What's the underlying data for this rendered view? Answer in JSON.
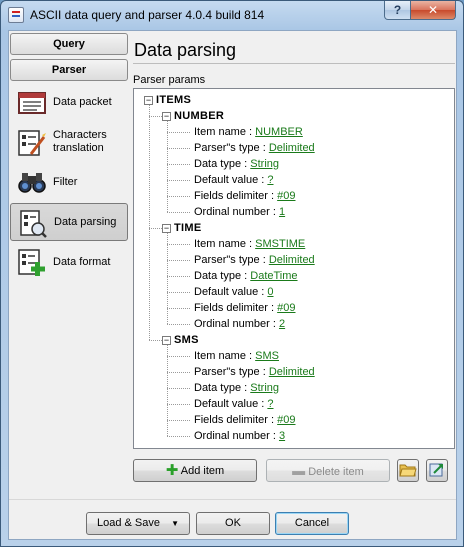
{
  "window": {
    "title": "ASCII data query and parser 4.0.4 build 814",
    "help_label": "?",
    "close_label": "✕"
  },
  "nav": {
    "query_label": "Query",
    "parser_label": "Parser",
    "items": [
      {
        "label": "Data packet",
        "icon": "data-packet-icon"
      },
      {
        "label": "Characters translation",
        "icon": "characters-translation-icon"
      },
      {
        "label": "Filter",
        "icon": "filter-binoculars-icon"
      },
      {
        "label": "Data parsing",
        "icon": "data-parsing-icon",
        "active": true
      },
      {
        "label": "Data format",
        "icon": "data-format-icon"
      }
    ]
  },
  "panel": {
    "title": "Data parsing",
    "params_label": "Parser params"
  },
  "tree": {
    "root": "ITEMS",
    "groups": [
      {
        "name": "NUMBER",
        "props": [
          {
            "name": "Item name : ",
            "value": "NUMBER"
          },
          {
            "name": "Parser\"s type : ",
            "value": "Delimited"
          },
          {
            "name": "Data type : ",
            "value": "String"
          },
          {
            "name": "Default value : ",
            "value": "?"
          },
          {
            "name": "Fields delimiter : ",
            "value": "#09"
          },
          {
            "name": "Ordinal number : ",
            "value": "1"
          }
        ]
      },
      {
        "name": "TIME",
        "props": [
          {
            "name": "Item name : ",
            "value": "SMSTIME"
          },
          {
            "name": "Parser\"s type : ",
            "value": "Delimited"
          },
          {
            "name": "Data type : ",
            "value": "DateTime"
          },
          {
            "name": "Default value : ",
            "value": "0"
          },
          {
            "name": "Fields delimiter : ",
            "value": "#09"
          },
          {
            "name": "Ordinal number : ",
            "value": "2"
          }
        ]
      },
      {
        "name": "SMS",
        "props": [
          {
            "name": "Item name : ",
            "value": "SMS"
          },
          {
            "name": "Parser\"s type : ",
            "value": "Delimited"
          },
          {
            "name": "Data type : ",
            "value": "String"
          },
          {
            "name": "Default value : ",
            "value": "?"
          },
          {
            "name": "Fields delimiter : ",
            "value": "#09"
          },
          {
            "name": "Ordinal number : ",
            "value": "3"
          }
        ]
      }
    ]
  },
  "actions": {
    "add_item": "Add item",
    "delete_item": "Delete item",
    "open_icon": "folder-open-icon",
    "save_icon": "export-icon"
  },
  "footer": {
    "load_save": "Load & Save",
    "ok": "OK",
    "cancel": "Cancel"
  },
  "colors": {
    "link_value": "#1a7a1a",
    "title_bar": "#a9c6e5",
    "close_button": "#c84a2c"
  }
}
